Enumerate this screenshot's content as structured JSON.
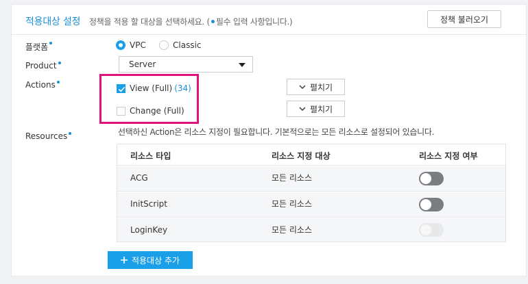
{
  "header": {
    "title": "적용대상 설정",
    "subtitle_before": "정책을 적용 할 대상을 선택하세요. (",
    "subtitle_after": "필수 입력 사항입니다.)",
    "import_button": "정책 불러오기"
  },
  "form": {
    "platform": {
      "label": "플랫폼",
      "options": [
        {
          "label": "VPC",
          "selected": true
        },
        {
          "label": "Classic",
          "selected": false
        }
      ]
    },
    "product": {
      "label": "Product",
      "selected": "Server"
    },
    "actions": {
      "label": "Actions",
      "items": [
        {
          "label": "View (Full)",
          "count": "(34)",
          "checked": true,
          "expand_label": "펼치기"
        },
        {
          "label": "Change (Full)",
          "count": "",
          "checked": false,
          "expand_label": "펼치기"
        }
      ]
    },
    "resources": {
      "label": "Resources",
      "note": "선택하신 Action은 리소스 지정이 필요합니다. 기본적으로는 모든 리소스로 설정되어 있습니다.",
      "table": {
        "headers": [
          "리소스 타입",
          "리소스 지정 대상",
          "리소스 지정 여부"
        ],
        "rows": [
          {
            "type": "ACG",
            "target": "모든 리소스",
            "toggle": "off"
          },
          {
            "type": "InitScript",
            "target": "모든 리소스",
            "toggle": "off"
          },
          {
            "type": "LoginKey",
            "target": "모든 리소스",
            "toggle": "disabled"
          }
        ]
      }
    }
  },
  "add_button": "적용대상 추가",
  "colors": {
    "accent": "#1aa0e8",
    "highlight": "#e0137d",
    "toggle_off": "#7a7d82"
  }
}
